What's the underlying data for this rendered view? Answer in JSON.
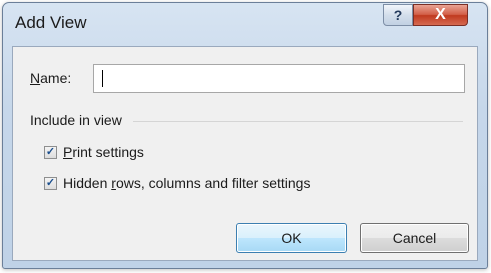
{
  "window": {
    "title": "Add View",
    "help_glyph": "?",
    "close_glyph": "X"
  },
  "name_field": {
    "label_prefix": "",
    "label_accel": "N",
    "label_rest": "ame:",
    "value": ""
  },
  "group": {
    "label": "Include in view"
  },
  "checkboxes": [
    {
      "label_accel": "P",
      "label_rest": "rint settings",
      "checked": true
    },
    {
      "label_prefix": "Hidden ",
      "label_accel": "r",
      "label_rest": "ows, columns and filter settings",
      "checked": true
    }
  ],
  "buttons": {
    "ok_label": "OK",
    "cancel_label": "Cancel"
  },
  "colors": {
    "frame": "#c6d7ea",
    "close": "#c0391f",
    "ok_border": "#3c7fb1"
  },
  "icons": {
    "help": "help-icon",
    "close": "close-icon",
    "check": "checkmark-icon"
  }
}
